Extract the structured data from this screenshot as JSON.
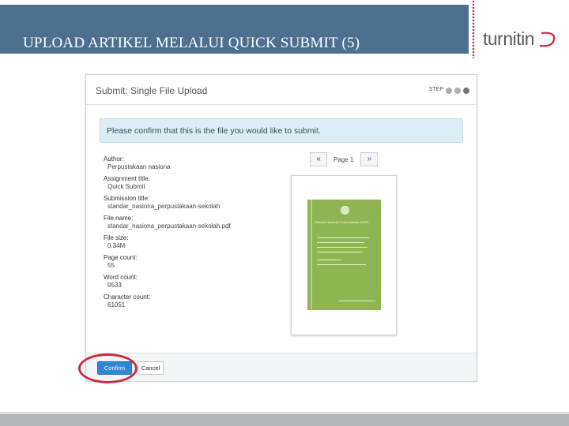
{
  "slide": {
    "title": "UPLOAD ARTIKEL MELALUI QUICK SUBMIT (5)",
    "logo_text": "turnitin"
  },
  "dialog": {
    "title": "Submit: Single File Upload",
    "step_label": "STEP",
    "steps_total": 3,
    "steps_active": 1,
    "info_message": "Please confirm that this is the file you would like to submit.",
    "fields": [
      {
        "label": "Author:",
        "value": "Perpustakaan nasiona"
      },
      {
        "label": "Assignment title:",
        "value": "Quick Submit"
      },
      {
        "label": "Submission title:",
        "value": "standar_nasiona_perpustakaan-sekolah"
      },
      {
        "label": "File name:",
        "value": "standar_nasiona_perpustakaan-sekolah.pdf"
      },
      {
        "label": "File size:",
        "value": "0.34M"
      },
      {
        "label": "Page count:",
        "value": "55"
      },
      {
        "label": "Word count:",
        "value": "9533"
      },
      {
        "label": "Character count:",
        "value": "61051"
      }
    ],
    "pager": {
      "prev": "«",
      "page_label": "Page 1",
      "next": "»"
    },
    "preview_cover_title": "Standar Nasional Perpustakaan (SNP)",
    "buttons": {
      "confirm": "Confirm",
      "cancel": "Cancel"
    }
  },
  "colors": {
    "header_bg": "#4d6f90",
    "accent_red": "#c62c43",
    "confirm_blue": "#2f87d6",
    "cover_green": "#8fb553"
  }
}
